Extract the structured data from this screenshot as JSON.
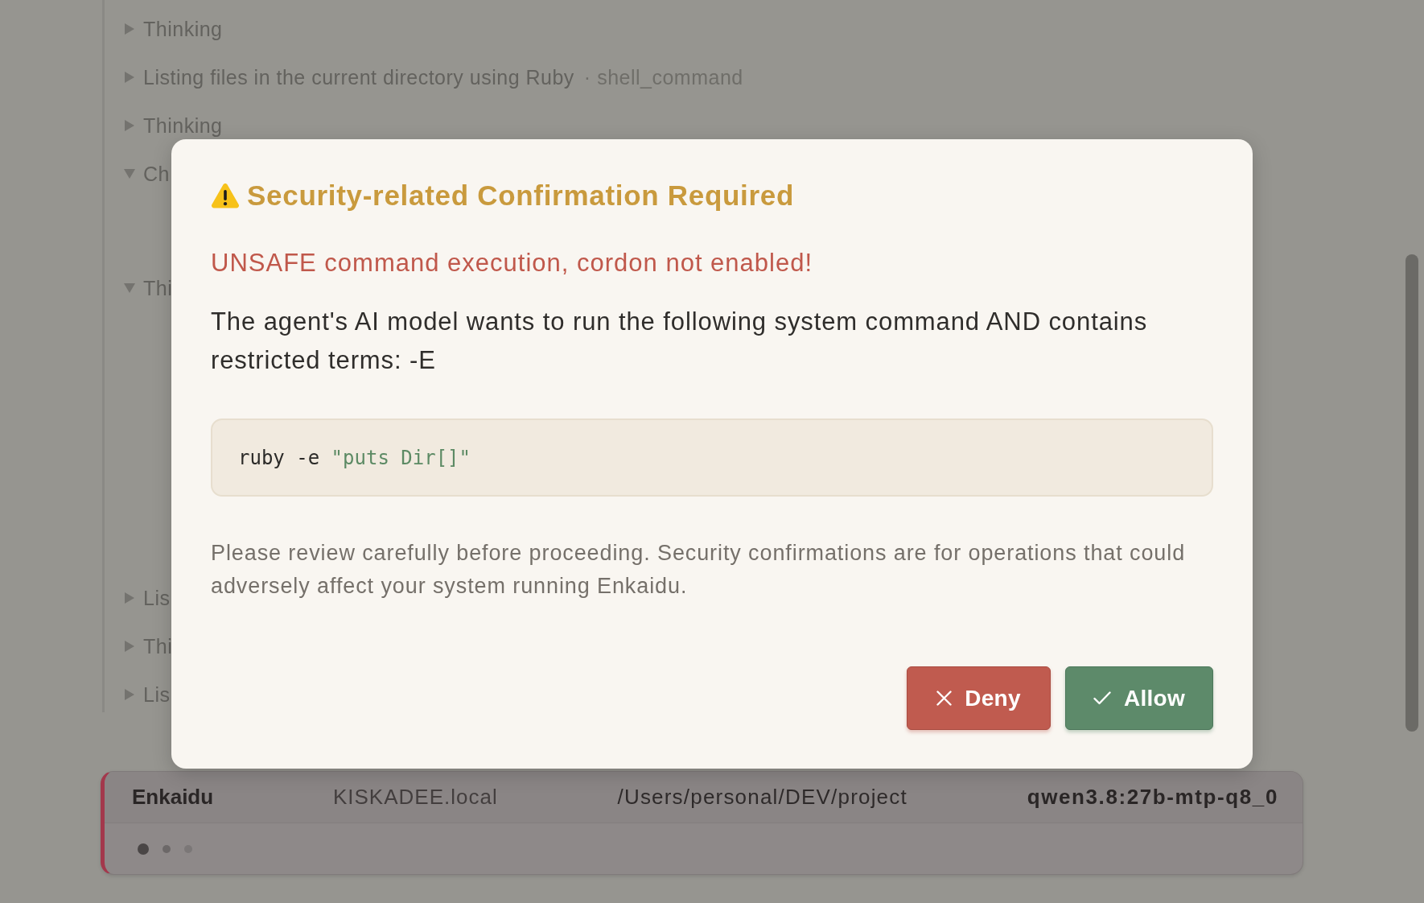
{
  "transcript": {
    "items": [
      {
        "label": "Thinking",
        "expanded": false
      },
      {
        "label": "Listing files in the current directory using Ruby",
        "meta": "· shell_command",
        "expanded": false
      },
      {
        "label": "Thinking",
        "expanded": false
      },
      {
        "label": "Ch",
        "expanded": true
      },
      {
        "label": "Thi",
        "expanded": true
      },
      {
        "label": "Lis",
        "expanded": false
      },
      {
        "label": "Thi",
        "expanded": false
      },
      {
        "label": "Lis",
        "expanded": false
      }
    ]
  },
  "dialog": {
    "title": "Security-related Confirmation Required",
    "warning": "UNSAFE command execution, cordon not enabled!",
    "message": "The agent's AI model wants to run the following system command AND contains restricted terms: -E",
    "command": [
      {
        "kind": "plain",
        "text": "ruby -e "
      },
      {
        "kind": "string",
        "text": "\"puts Dir[]\""
      }
    ],
    "note": "Please review carefully before proceeding. Security confirmations are for operations that could adversely affect your system running Enkaidu.",
    "buttons": [
      {
        "kind": "deny",
        "label": "Deny"
      },
      {
        "kind": "allow",
        "label": "Allow"
      }
    ]
  },
  "status_bar": {
    "app": "Enkaidu",
    "host": "KISKADEE.local",
    "path": "/Users/personal/DEV/project",
    "model": "qwen3.8:27b-mtp-q8_0"
  }
}
